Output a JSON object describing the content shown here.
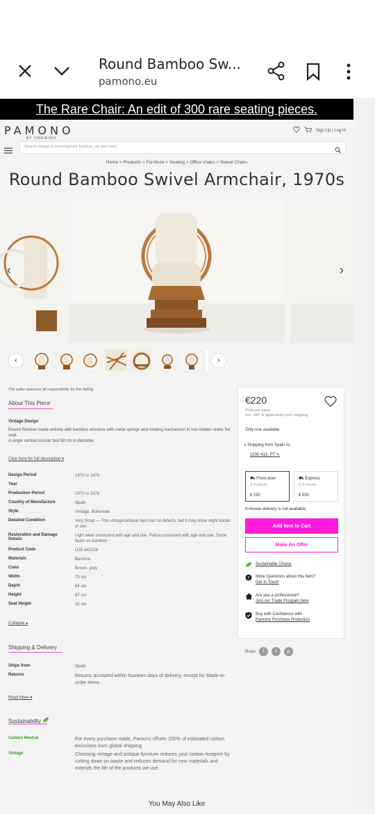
{
  "browser": {
    "title": "Round Bamboo Sw...",
    "url": "pamono.eu"
  },
  "promo": "The Rare Chair: An edit of 300 rare seating pieces.",
  "header": {
    "logo": "PAMONO",
    "logo_sub": "BY CHAIRISH",
    "signup": "Sign Up | Log In",
    "search_placeholder": "Search vintage & contemporary furniture, art and more"
  },
  "breadcrumb": "Home > Products > Furniture > Seating > Office chairs > Swivel Chairs",
  "product_title": "Round Bamboo Swivel Armchair, 1970s",
  "seller_note": "The seller assumes all responsibility for this listing.",
  "about": {
    "title": "About This Piece",
    "subtitle": "Vintage Design",
    "desc1": "Round Recliner made entirely with bamboo structure with metal springs and rotating mechanism in iron hidden under the seat.",
    "desc2": "A single central circular foot 58 cm in diameter.",
    "full_desc_link": "Click here for full description",
    "collapse": "Collapse"
  },
  "specs": [
    {
      "k": "Design Period",
      "v": "1970 to 1979"
    },
    {
      "k": "Year",
      "v": ""
    },
    {
      "k": "Production Period",
      "v": "1970 to 1979"
    },
    {
      "k": "Country of Manufacture",
      "v": "Spain"
    },
    {
      "k": "Style",
      "v": "Vintage, Bohemian"
    },
    {
      "k": "Detailed Condition",
      "v": "Very Good — This vintage/antique item has no defects, but it may show slight traces of use."
    },
    {
      "k": "Restoration and Damage Details",
      "v": "Light wear consistent with age and use, Patina consistent with age and use, Some faults on bamboo"
    },
    {
      "k": "Product Code",
      "v": "UJE-841518"
    },
    {
      "k": "Materials",
      "v": "Bamboo"
    },
    {
      "k": "Color",
      "v": "Brown, grey"
    },
    {
      "k": "Width",
      "v": "70 cm"
    },
    {
      "k": "Depth",
      "v": "64 cm"
    },
    {
      "k": "Height",
      "v": "87 cm"
    },
    {
      "k": "Seat Height",
      "v": "43 cm"
    }
  ],
  "shipping": {
    "title": "Shipping & Delivery",
    "ships_from_k": "Ships from",
    "ships_from_v": "Spain",
    "returns_k": "Returns",
    "returns_v": "Returns accepted within fourteen days of delivery, except for Made-to-order items",
    "read_more": "Read More"
  },
  "sustainability": {
    "title": "Sustainability",
    "carbon_k": "Carbon Neutral",
    "carbon_v": "For every purchase made, Pamono offsets 100% of estimated carbon emissions from global shipping.",
    "vintage_k": "Vintage",
    "vintage_v": "Choosing vintage and antique furniture reduces your carbon footprint by cutting down on waste and reduces demand for new materials and extends the life of the products we use."
  },
  "card": {
    "price": "€220",
    "price_per": "Price per piece",
    "price_note": "Incl. VAT (if applicable) excl. shipping",
    "availability": "Only one available",
    "shipping_from": "Shipping from Spain to:",
    "postcode": "1500-415, PT",
    "front_door": "Front-door",
    "front_weeks": "3-4 weeks",
    "front_price": "€ 292",
    "express": "Express",
    "express_weeks": "2-3 weeks",
    "express_price": "€ 650",
    "inhouse": "In-house delivery is not available",
    "add_cart": "Add Item to Cart",
    "make_offer": "Make An Offer",
    "sustainable": "Sustainable Choice",
    "questions": "More Questions about this item?",
    "get_in_touch": "Get in Touch",
    "pro": "Are you a professional?",
    "trade": "Join our Trade Program here",
    "confidence": "Buy with Confidence with",
    "protection": "Pamono Purchase Protection"
  },
  "share_label": "Share",
  "also_like": "You May Also Like",
  "colors": {
    "accent": "#ff1ad9",
    "green": "#3a9a2a",
    "promo_bg": "#000000"
  }
}
